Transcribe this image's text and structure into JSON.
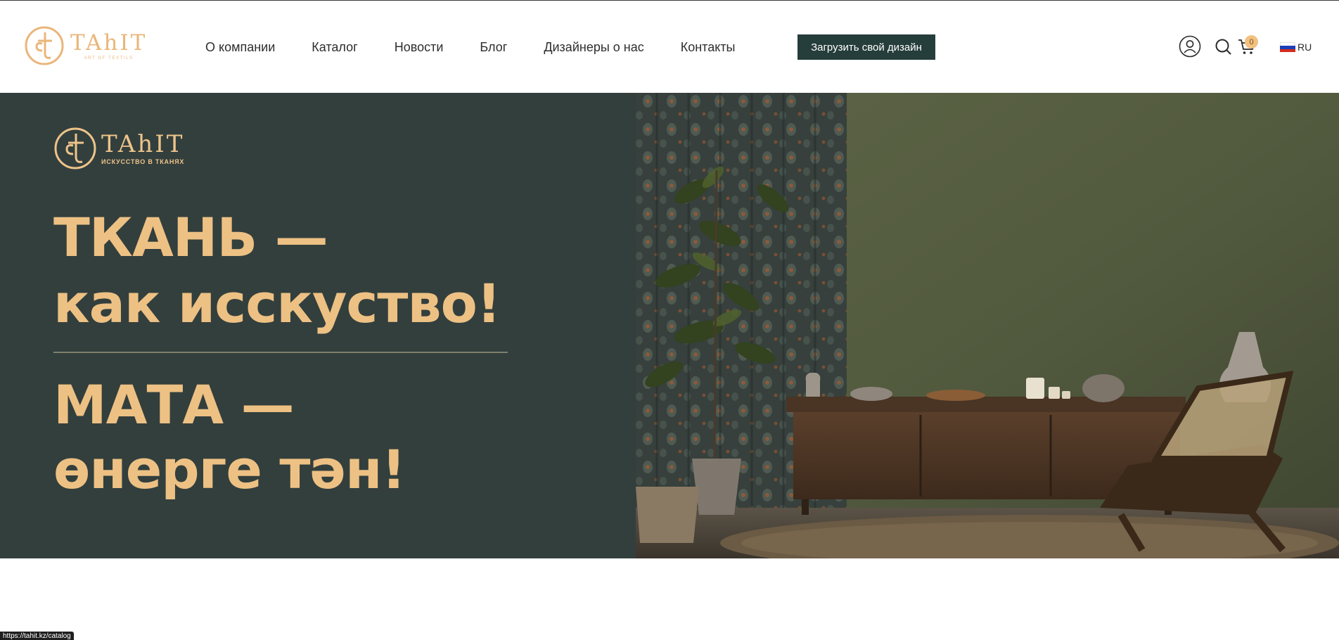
{
  "brand": {
    "logo_word": "TAhIT",
    "logo_tagline": "ART OF TEXTILS",
    "colors": {
      "accent": "#eab67a",
      "dark": "#253d3b",
      "hero_bg": "#333f3d",
      "headline": "#edc184"
    }
  },
  "nav": {
    "items": [
      {
        "label": "О компании"
      },
      {
        "label": "Каталог"
      },
      {
        "label": "Новости"
      },
      {
        "label": "Блог"
      },
      {
        "label": "Дизайнеры о нас"
      },
      {
        "label": "Контакты"
      }
    ],
    "upload_button": "Загрузить свой дизайн"
  },
  "header_tools": {
    "user_icon": "user-circle-icon",
    "search_icon": "search-icon",
    "cart_icon": "cart-icon",
    "cart_count": "0",
    "language": "RU",
    "flag": "russia-flag-icon"
  },
  "hero": {
    "logo_word": "TAhIT",
    "logo_tagline": "ИСКУССТВО В ТКАНЯХ",
    "line1": "ТКАНЬ  —",
    "line2": "как исскуство!",
    "line3": "МАТА  —",
    "line4": "өнерге тән!",
    "image": "interior-photo: green wall, patterned curtains, plant, wooden sideboard with vases, rattan chair, rug"
  },
  "status_bar": {
    "url": "https://tahit.kz/catalog"
  }
}
